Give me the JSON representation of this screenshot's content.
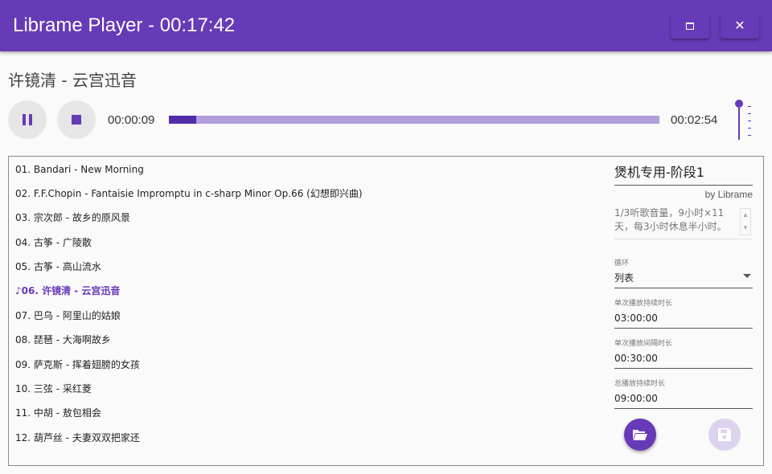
{
  "window": {
    "title": "Librame Player - 00:17:42",
    "maximize_icon": "maximize-icon",
    "close_icon": "close-icon",
    "close_glyph": "✕"
  },
  "now_playing": {
    "title": "许镜清 - 云宫迅音",
    "elapsed": "00:00:09",
    "duration": "00:02:54",
    "progress_fraction": 0.055,
    "volume_fraction": 1.0
  },
  "playlist": {
    "items": [
      {
        "label": "01. Bandari - New Morning",
        "active": false
      },
      {
        "label": "02. F.F.Chopin - Fantaisie Impromptu in c-sharp Minor Op.66 (幻想即兴曲)",
        "active": false
      },
      {
        "label": "03. 宗次郎 - 故乡的原风景",
        "active": false
      },
      {
        "label": "04. 古筝 - 广陵散",
        "active": false
      },
      {
        "label": "05. 古筝 - 高山流水",
        "active": false
      },
      {
        "label": "♪06. 许镜清 - 云宫迅音",
        "active": true
      },
      {
        "label": "07. 巴乌 - 阿里山的姑娘",
        "active": false
      },
      {
        "label": "08. 琵琶 - 大海啊故乡",
        "active": false
      },
      {
        "label": "09. 萨克斯 - 挥着翅膀的女孩",
        "active": false
      },
      {
        "label": "10. 三弦 - 采红菱",
        "active": false
      },
      {
        "label": "11. 中胡 - 敖包相会",
        "active": false
      },
      {
        "label": "12. 葫芦丝 - 夫妻双双把家还",
        "active": false
      }
    ]
  },
  "plan": {
    "name": "煲机专用-阶段1",
    "author": "by Librame",
    "description": "1/3听歌音量，9小时×11天，每3小时休息半小时。",
    "loop": {
      "label": "循环",
      "value": "列表"
    },
    "single_duration": {
      "label": "单次播放持续时长",
      "value": "03:00:00"
    },
    "single_interval": {
      "label": "单次播放间隔时长",
      "value": "00:30:00"
    },
    "total_duration": {
      "label": "总播放持续时长",
      "value": "09:00:00"
    }
  },
  "colors": {
    "primary": "#673ab7",
    "progress_fill": "#512da8",
    "progress_track": "#b39ddb",
    "disabled_fab": "#ddd3ee"
  },
  "icons": {
    "pause": "pause-icon",
    "stop": "stop-icon",
    "open_folder": "folder-open-icon",
    "save": "save-icon"
  }
}
